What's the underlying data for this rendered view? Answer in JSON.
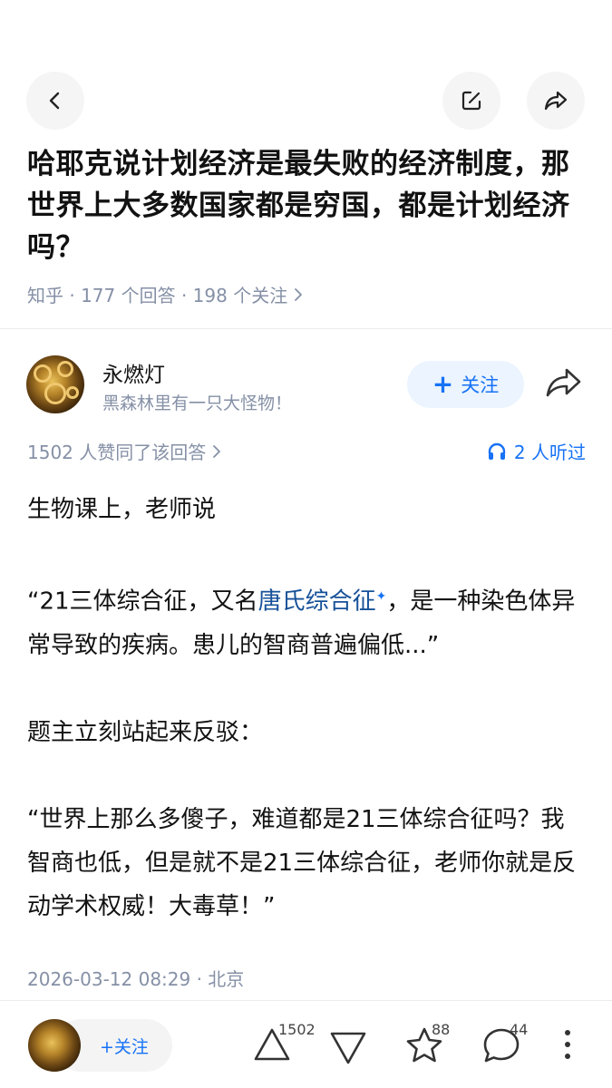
{
  "question": {
    "title": "哈耶克说计划经济是最失败的经济制度，那世界上大多数国家都是穷国，都是计划经济吗？",
    "meta": "知乎 · 177 个回答 · 198 个关注"
  },
  "author": {
    "name": "永燃灯",
    "bio": "黑森林里有一只大怪物！",
    "follow_label": "关注"
  },
  "answer": {
    "agree_text": "1502 人赞同了该回答",
    "listeners_text": "2 人听过",
    "paragraphs": {
      "p1": "生物课上，老师说",
      "p2_before": "“21三体综合征，又名",
      "p2_link": "唐氏综合征",
      "p2_after": "，是一种染色体异常导致的疾病。患儿的智商普遍偏低...”",
      "p3": "题主立刻站起来反驳：",
      "p4": "“世界上那么多傻子，难道都是21三体综合征吗？我智商也低，但是就不是21三体综合征，老师你就是反动学术权威！大毒草！”"
    },
    "timestamp": "2026-03-12 08:29 · 北京"
  },
  "bottom_bar": {
    "follow_label": "+关注",
    "upvote_count": "1502",
    "favorite_count": "88",
    "comment_count": "44"
  },
  "icons": {
    "back": "chevron-left-icon",
    "edit": "edit-icon",
    "share": "share-icon",
    "headphones": "headphones-icon",
    "upvote": "triangle-up-icon",
    "downvote": "triangle-down-icon",
    "favorite": "star-icon",
    "comment": "comment-icon",
    "more": "more-vertical-icon"
  },
  "colors": {
    "accent": "#1772f6",
    "link": "#175199",
    "meta": "#8590a6",
    "follow_bg": "#ebf4ff"
  }
}
